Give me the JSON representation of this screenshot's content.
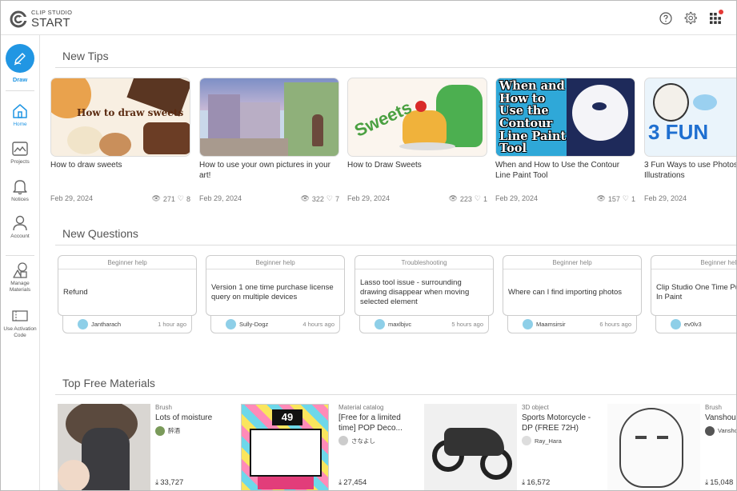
{
  "app": {
    "logo_small": "CLIP STUDIO",
    "logo_big": "START"
  },
  "sidebar": {
    "draw_label": "Draw",
    "items": [
      {
        "label": "Home",
        "icon": "home-icon"
      },
      {
        "label": "Projects",
        "icon": "projects-icon"
      },
      {
        "label": "Notices",
        "icon": "bell-icon"
      },
      {
        "label": "Account",
        "icon": "account-icon"
      },
      {
        "label": "Manage Materials",
        "icon": "shapes-icon"
      },
      {
        "label": "Use Activation Code",
        "icon": "ticket-icon"
      }
    ]
  },
  "sections": {
    "tips": "New Tips",
    "questions": "New Questions",
    "materials": "Top Free Materials"
  },
  "tips": [
    {
      "title": "How to draw sweets",
      "date": "Feb 29, 2024",
      "views": "271",
      "likes": "8",
      "thumb_text": "How to draw sweets"
    },
    {
      "title": "How to use your own pictures in your art!",
      "date": "Feb 29, 2024",
      "views": "322",
      "likes": "7",
      "thumb_text": ""
    },
    {
      "title": "How to Draw Sweets",
      "date": "Feb 29, 2024",
      "views": "223",
      "likes": "1",
      "thumb_text": "Sweets"
    },
    {
      "title": "When and How to Use the Contour Line Paint Tool",
      "date": "Feb 29, 2024",
      "views": "157",
      "likes": "1",
      "thumb_text": "When and How to Use the Contour Line Paint Tool"
    },
    {
      "title": "3 Fun Ways to use Photos in Illustrations",
      "date": "Feb 29, 2024",
      "views": "",
      "likes": "",
      "thumb_text": "3 FUN"
    }
  ],
  "questions": [
    {
      "category": "Beginner help",
      "text": "Refund",
      "user": "Jantharach",
      "time": "1 hour ago"
    },
    {
      "category": "Beginner help",
      "text": "Version 1 one time purchase license query on multiple devices",
      "user": "Sully-Dogz",
      "time": "4 hours ago"
    },
    {
      "category": "Troubleshooting",
      "text": "Lasso tool issue - surrounding drawing disappear when moving selected element",
      "user": "maxlbjvc",
      "time": "5 hours ago"
    },
    {
      "category": "Beginner help",
      "text": "Where can I find importing photos",
      "user": "Maamsirsir",
      "time": "6 hours ago"
    },
    {
      "category": "Beginner help",
      "text": "Clip Studio One Time Pu... Show Up In Paint",
      "user": "ev0lv3",
      "time": ""
    }
  ],
  "materials": [
    {
      "category": "Brush",
      "name": "Lots of moisture",
      "author": "醉酒",
      "downloads": "33,727"
    },
    {
      "category": "Material catalog",
      "name": "[Free for a limited time] POP Deco...",
      "author": "さなよし",
      "downloads": "27,454"
    },
    {
      "category": "3D object",
      "name": "Sports Motorcycle - DP (FREE 72H)",
      "author": "Ray_Hara",
      "downloads": "16,572"
    },
    {
      "category": "Brush",
      "name": "Vanshou",
      "author": "Vansho",
      "downloads": "15,048"
    }
  ],
  "colors": {
    "accent": "#2196e3",
    "notification": "#e53935"
  }
}
